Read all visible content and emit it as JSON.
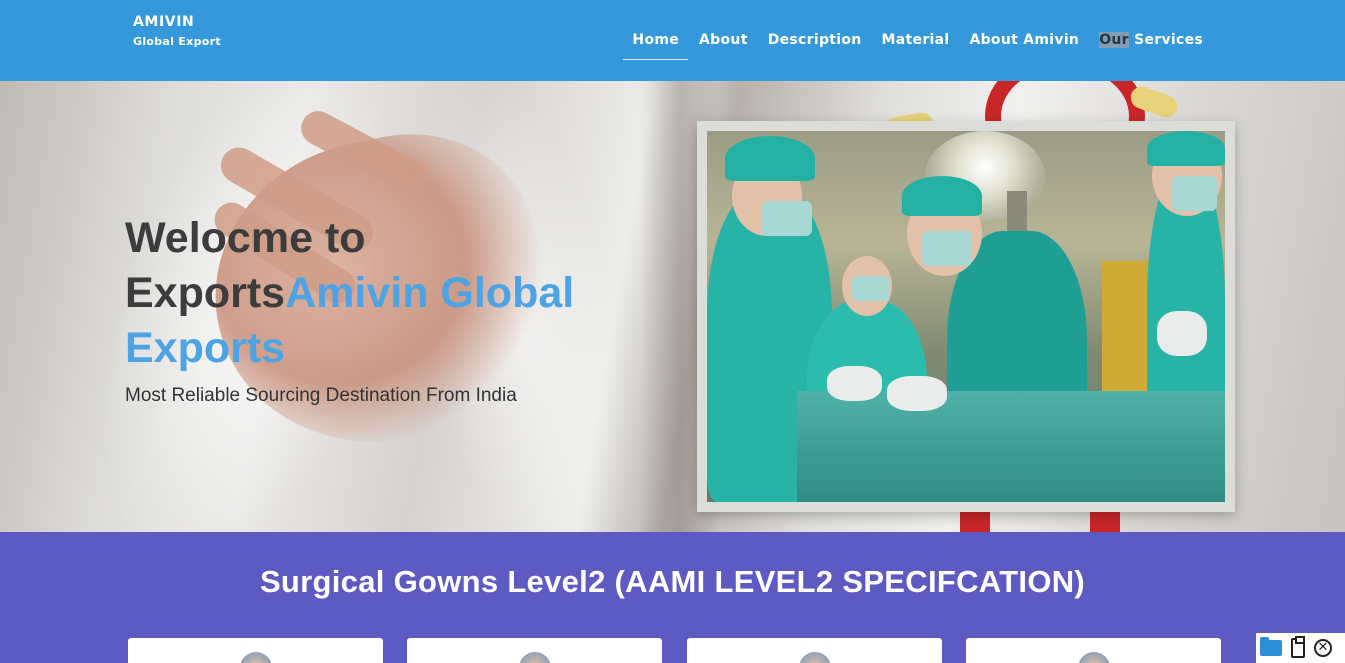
{
  "brand": {
    "name": "AMIVIN",
    "tagline": "Global Export"
  },
  "nav": {
    "items": [
      {
        "label": "Home",
        "active": true
      },
      {
        "label": "About"
      },
      {
        "label": "Description"
      },
      {
        "label": "Material"
      },
      {
        "label": "About Amivin"
      }
    ],
    "services_part1": "Our",
    "services_part2": " Services"
  },
  "hero": {
    "title_plain": "Welocme to Exports",
    "title_accent": "Amivin Global Exports",
    "subtitle": "Most Reliable Sourcing Destination From India",
    "image_icon": "surgical-team-photo"
  },
  "products": {
    "title": "Surgical Gowns Level2 (AAMI LEVEL2 SPECIFCATION)",
    "card_count_visible": 4
  },
  "tray": {
    "icons": [
      "folder-icon",
      "clipboard-icon",
      "close-circle-icon"
    ],
    "close_glyph": "✕"
  },
  "colors": {
    "header": "#3498db",
    "accent_text": "#4ea3e4",
    "section_bg": "#5d5bc2"
  }
}
